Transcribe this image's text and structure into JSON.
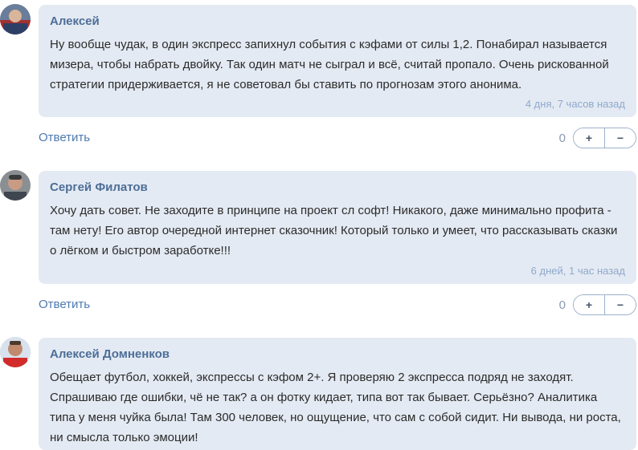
{
  "comments": [
    {
      "author": "Алексей",
      "text": "Ну вообще чудак, в один экспресс запихнул события с кэфами от силы 1,2. Понабирал называется мизера, чтобы набрать двойку. Так один матч не сыграл и всё, считай пропало. Очень рискованной стратегии придерживается, я не советовал бы ставить по прогнозам этого анонима.",
      "time": "4 дня, 7 часов назад",
      "reply_label": "Ответить",
      "votes": "0",
      "plus_label": "+",
      "minus_label": "−"
    },
    {
      "author": "Сергей Филатов",
      "text": "Хочу дать совет. Не заходите в принципе на проект сл софт! Никакого, даже минимально профита - там нету! Его автор очередной интернет сказочник! Который только и умеет, что рассказывать сказки о лёгком и быстром заработке!!!",
      "time": "6 дней, 1 час назад",
      "reply_label": "Ответить",
      "votes": "0",
      "plus_label": "+",
      "minus_label": "−"
    },
    {
      "author": "Алексей Домненков",
      "text": "Обещает футбол, хоккей, экспрессы с кэфом 2+. Я проверяю 2 экспресса подряд не заходят. Спрашиваю где ошибки, чё не так? а он фотку кидает, типа вот так бывает. Серьёзно? Аналитика типа у меня чуйка была! Там 300 человек, но ощущение, что сам с собой сидит. Ни вывода, ни роста, ни смысла только эмоции!"
    }
  ]
}
